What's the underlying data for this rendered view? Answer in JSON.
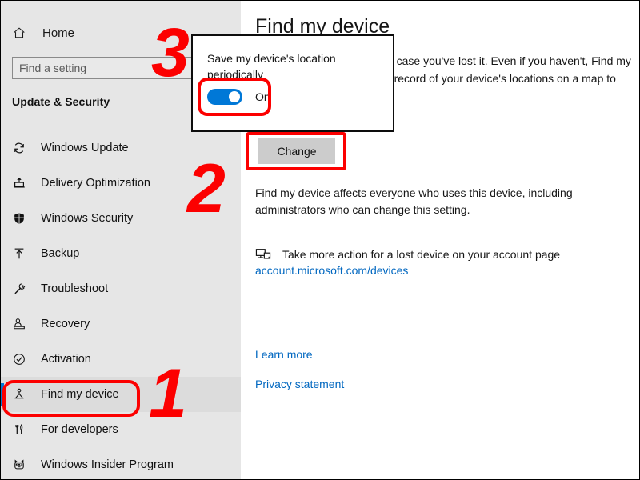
{
  "window": {
    "app": "Windows Settings"
  },
  "sidebar": {
    "home": {
      "label": "Home",
      "icon": "home-icon"
    },
    "search": {
      "placeholder": "Find a setting",
      "value": "",
      "icon": "search-input"
    },
    "section_title": "Update & Security",
    "items": [
      {
        "label": "Windows Update",
        "icon": "sync-icon",
        "selected": false
      },
      {
        "label": "Delivery Optimization",
        "icon": "delivery-box-icon",
        "selected": false
      },
      {
        "label": "Windows Security",
        "icon": "shield-icon",
        "selected": false
      },
      {
        "label": "Backup",
        "icon": "backup-upload-icon",
        "selected": false
      },
      {
        "label": "Troubleshoot",
        "icon": "wrench-icon",
        "selected": false
      },
      {
        "label": "Recovery",
        "icon": "recovery-icon",
        "selected": false
      },
      {
        "label": "Activation",
        "icon": "check-circle-icon",
        "selected": false
      },
      {
        "label": "Find my device",
        "icon": "find-my-device-icon",
        "selected": true
      },
      {
        "label": "For developers",
        "icon": "developer-tools-icon",
        "selected": false
      },
      {
        "label": "Windows Insider Program",
        "icon": "ninjacat-icon",
        "selected": false
      }
    ]
  },
  "main": {
    "title": "Find my device",
    "intro": "Keep track of your device in case you've lost it. Even if you haven't, Find my device can help you keep a record of your device's locations on a map to help you find it.",
    "change_button": "Change",
    "affects_text": "Find my device affects everyone who uses this device, including administrators who can change this setting.",
    "account_action": "Take more action for a lost device on your account page",
    "account_link": "account.microsoft.com/devices",
    "learn_more": "Learn more",
    "privacy_statement": "Privacy statement"
  },
  "popup": {
    "label": "Save my device's location periodically",
    "toggle_state": "On",
    "toggle_on": true
  },
  "annotations": {
    "step1": "1",
    "step2": "2",
    "step3": "3"
  },
  "colors": {
    "accent": "#0078d7",
    "link": "#0067c0",
    "annotation_red": "#fc0000",
    "sidebar_bg": "#e6e6e6",
    "button_bg": "#cccccc"
  }
}
